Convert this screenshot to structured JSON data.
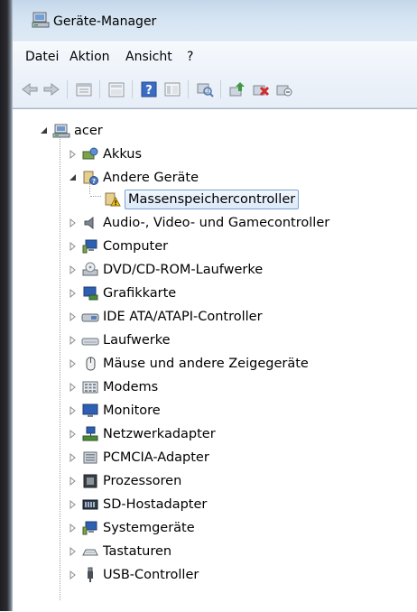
{
  "window": {
    "title": "Geräte-Manager"
  },
  "menu": [
    {
      "id": "datei",
      "label": "Datei"
    },
    {
      "id": "aktion",
      "label": "Aktion"
    },
    {
      "id": "ansicht",
      "label": "Ansicht"
    },
    {
      "id": "help",
      "label": "?"
    }
  ],
  "toolbar": [
    "back-icon",
    "forward-icon",
    "properties-icon",
    "show-hide-tree-icon",
    "help-icon",
    "details-icon",
    "scan-hardware-icon",
    "update-driver-icon",
    "uninstall-icon",
    "disable-icon"
  ],
  "tree": {
    "root": "acer",
    "nodes": [
      {
        "label": "Akkus",
        "icon": "battery-icon"
      },
      {
        "label": "Andere Geräte",
        "icon": "unknown-device-icon",
        "expanded": true,
        "children": [
          {
            "label": "Massenspeichercontroller",
            "icon": "warning-device-icon",
            "selected": true
          }
        ]
      },
      {
        "label": "Audio-, Video- und Gamecontroller",
        "icon": "speaker-icon"
      },
      {
        "label": "Computer",
        "icon": "computer-icon"
      },
      {
        "label": "DVD/CD-ROM-Laufwerke",
        "icon": "dvd-drive-icon"
      },
      {
        "label": "Grafikkarte",
        "icon": "display-adapter-icon"
      },
      {
        "label": "IDE ATA/ATAPI-Controller",
        "icon": "ide-controller-icon"
      },
      {
        "label": "Laufwerke",
        "icon": "disk-drive-icon"
      },
      {
        "label": "Mäuse und andere Zeigegeräte",
        "icon": "mouse-icon"
      },
      {
        "label": "Modems",
        "icon": "modem-icon"
      },
      {
        "label": "Monitore",
        "icon": "monitor-icon"
      },
      {
        "label": "Netzwerkadapter",
        "icon": "network-adapter-icon"
      },
      {
        "label": "PCMCIA-Adapter",
        "icon": "pcmcia-icon"
      },
      {
        "label": "Prozessoren",
        "icon": "processor-icon"
      },
      {
        "label": "SD-Hostadapter",
        "icon": "sd-host-icon"
      },
      {
        "label": "Systemgeräte",
        "icon": "system-device-icon"
      },
      {
        "label": "Tastaturen",
        "icon": "keyboard-icon"
      },
      {
        "label": "USB-Controller",
        "icon": "usb-icon"
      }
    ]
  }
}
